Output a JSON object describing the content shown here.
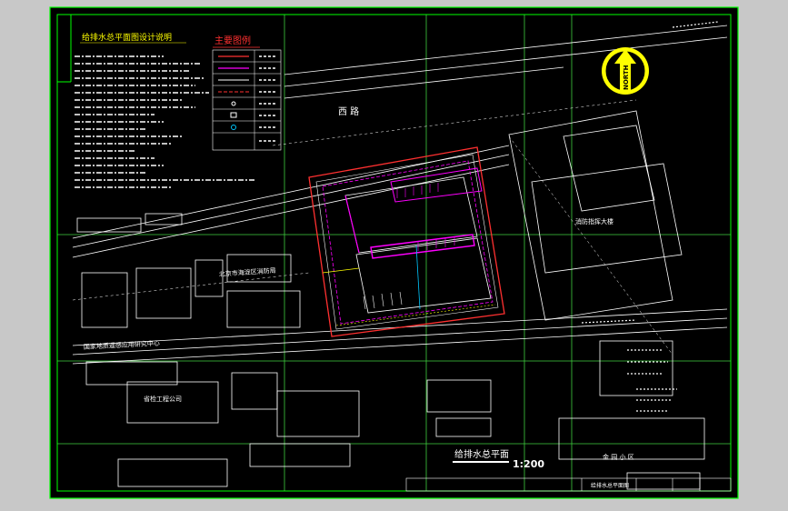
{
  "drawing": {
    "title": "给排水总平面",
    "scale": "1:200",
    "notes_title": "给排水总平面图设计说明",
    "legend_title": "主要图例",
    "compass_label": "NORTH",
    "buildings": {
      "east": "消防指挥大楼",
      "middle": "北京市海淀区消防局",
      "west_lower": "国家地质遥感应用研究中心",
      "southwest": "省检工程公司",
      "southeast": "金 园 小 区"
    },
    "road_label": "西 路",
    "title_block": "给排水总平面图"
  },
  "colors": {
    "background": "#000000",
    "frame": "#00ff00",
    "grid": "#40c040",
    "white": "#ffffff",
    "yellow": "#ffff00",
    "magenta": "#ff00ff",
    "red": "#ff3030",
    "cyan": "#00c8ff"
  }
}
